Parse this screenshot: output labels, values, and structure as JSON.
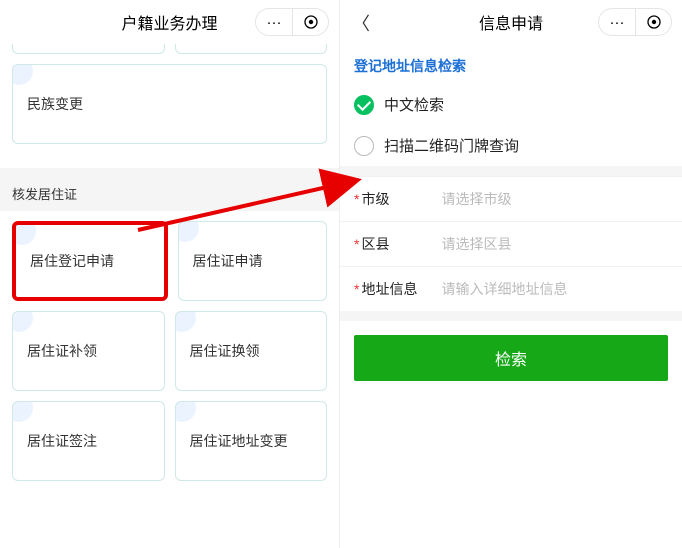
{
  "left": {
    "title": "户籍业务办理",
    "card_ethnic": "民族变更",
    "section": "核发居住证",
    "cards": {
      "reg_apply": "居住登记申请",
      "permit_apply": "居住证申请",
      "reissue": "居住证补领",
      "renew": "居住证换领",
      "endorse": "居住证签注",
      "addr_change": "居住证地址变更"
    }
  },
  "right": {
    "title": "信息申请",
    "subheader": "登记地址信息检索",
    "opt_cn": "中文检索",
    "opt_qr": "扫描二维码门牌查询",
    "city_label": "市级",
    "city_ph": "请选择市级",
    "district_label": "区县",
    "district_ph": "请选择区县",
    "addr_label": "地址信息",
    "addr_ph": "请输入详细地址信息",
    "search_btn": "检索"
  }
}
